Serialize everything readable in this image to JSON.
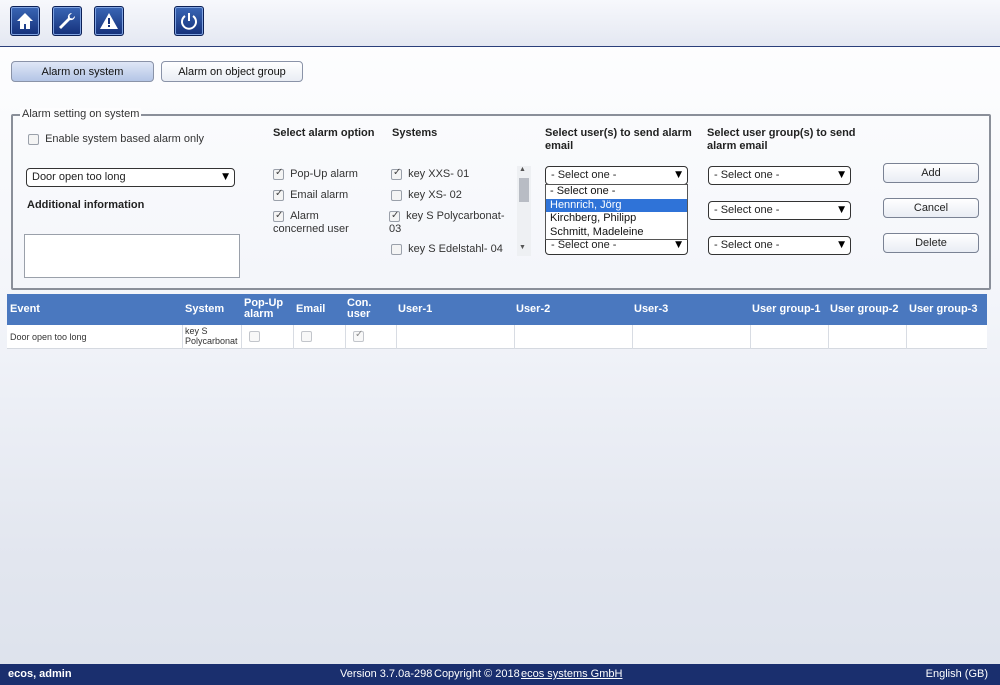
{
  "toolbar": {
    "buttons": [
      "home-icon",
      "wrench-icon",
      "warning-icon",
      "power-icon"
    ]
  },
  "tabs": {
    "alarm_on_system": "Alarm on system",
    "alarm_on_object_group": "Alarm on object group"
  },
  "form": {
    "legend": "Alarm setting on system",
    "enable_system_only": "Enable system based alarm only",
    "event_select": "Door open too long",
    "additional_info_label": "Additional information",
    "alarm_option_header": "Select alarm option",
    "options": [
      {
        "label": "Pop-Up alarm",
        "checked": true
      },
      {
        "label": "Email alarm",
        "checked": true
      },
      {
        "label": "Alarm concerned user",
        "checked": true
      }
    ],
    "systems_header": "Systems",
    "systems": [
      {
        "label": "key XXS- 01",
        "checked": true
      },
      {
        "label": "key XS- 02",
        "checked": false
      },
      {
        "label": "key S Polycarbonat-03",
        "checked": true
      },
      {
        "label": "key S Edelstahl- 04",
        "checked": false
      }
    ],
    "users_header": "Select user(s) to send alarm email",
    "user_selects": [
      "- Select one -",
      "- Select one -"
    ],
    "user_dropdown_options": [
      "- Select one -",
      "Hennrich, Jörg",
      "Kirchberg, Philipp",
      "Schmitt, Madeleine"
    ],
    "user_dropdown_selected_index": 1,
    "groups_header": "Select user group(s) to send alarm email",
    "group_selects": [
      "- Select one -",
      "- Select one -",
      "- Select one -"
    ],
    "buttons": {
      "add": "Add",
      "cancel": "Cancel",
      "delete": "Delete"
    }
  },
  "table": {
    "columns": [
      "Event",
      "System",
      "Pop-Up alarm",
      "Email",
      "Con. user",
      "User-1",
      "User-2",
      "User-3",
      "User group-1",
      "User group-2",
      "User group-3"
    ],
    "rows": [
      {
        "event": "Door open too long",
        "system": "key S Polycarbonat",
        "popup": false,
        "email": false,
        "con_user": true
      }
    ]
  },
  "footer": {
    "user": "ecos, admin",
    "version": "Version 3.7.0a-298",
    "copyright": "Copyright © 2018",
    "company": "ecos systems GmbH",
    "language": "English (GB)"
  },
  "colors": {
    "accent": "#1a2f6e",
    "table_header": "#4a78bf",
    "selection": "#2f73d8"
  }
}
